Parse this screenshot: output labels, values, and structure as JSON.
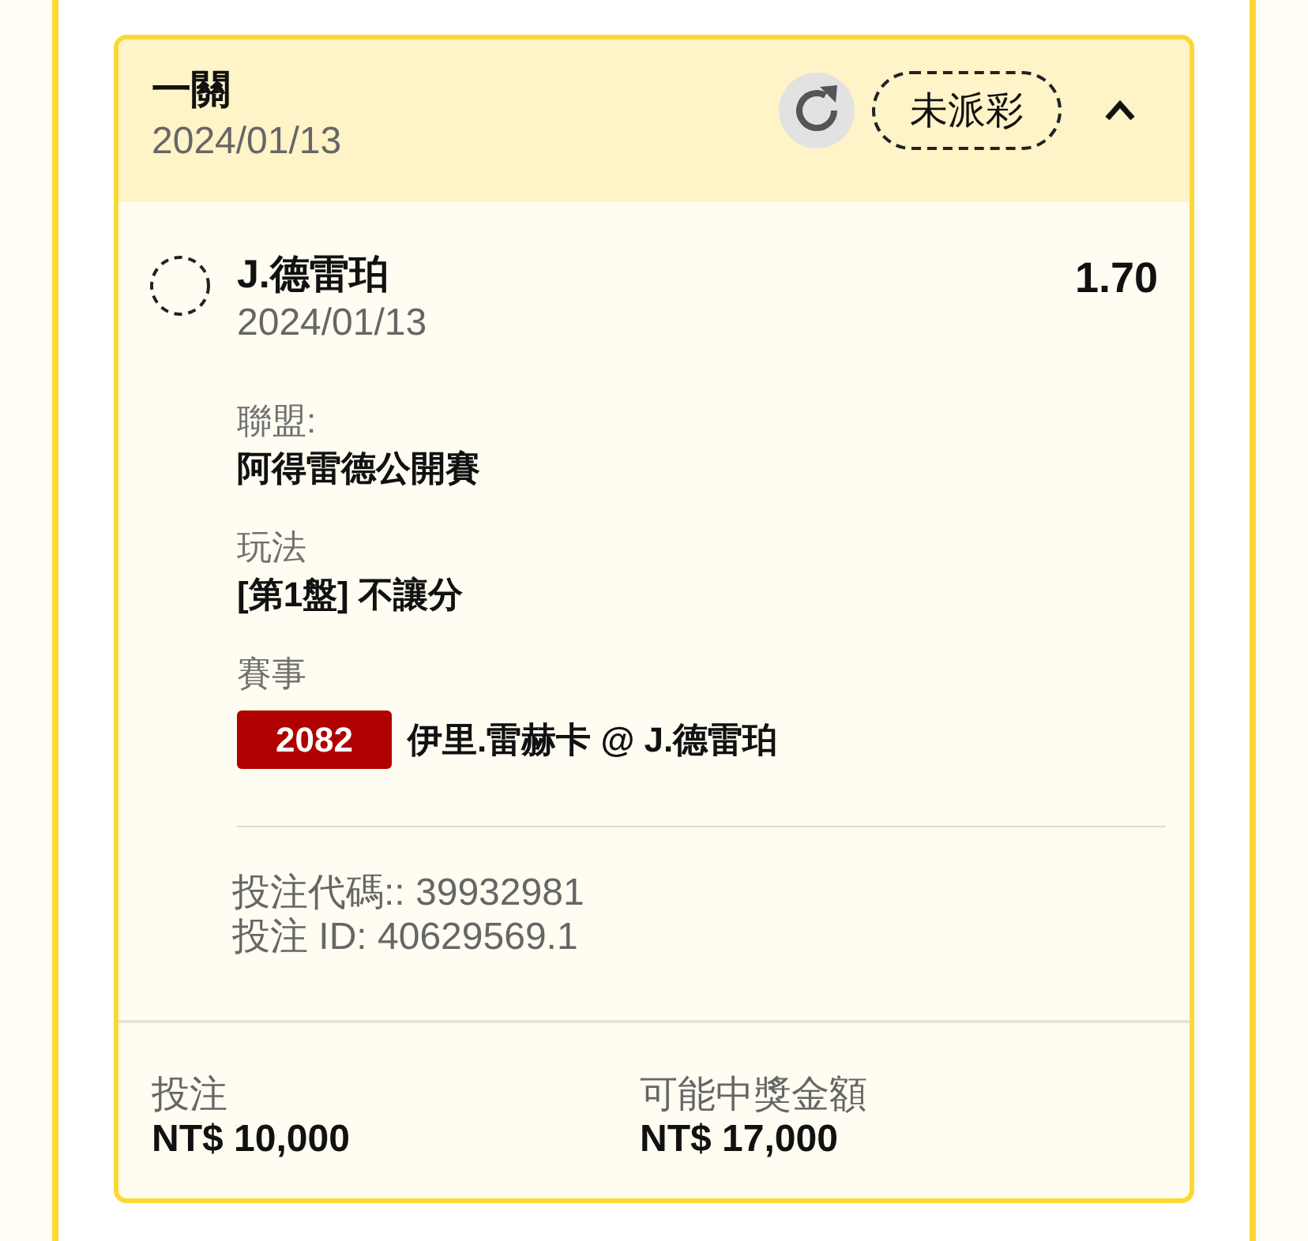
{
  "bet_card": {
    "title": "一關",
    "date": "2024/01/13",
    "status": "未派彩",
    "expanded": true
  },
  "selection": {
    "name": "J.德雷珀",
    "date": "2024/01/13",
    "odds": "1.70"
  },
  "details": [
    {
      "kind": "text",
      "label": "聯盟:",
      "value": "阿得雷德公開賽"
    },
    {
      "kind": "text",
      "label": "玩法",
      "value": "[第1盤] 不讓分"
    },
    {
      "kind": "event",
      "label": "賽事",
      "badge": "2082",
      "value": "伊里.雷赫卡 @ J.德雷珀"
    }
  ],
  "codes": [
    "投注代碼:: 39932981",
    "投注 ID: 40629569.1"
  ],
  "totals": [
    {
      "label": "投注",
      "value": "NT$ 10,000"
    },
    {
      "label": "可能中獎金額",
      "value": "NT$ 17,000"
    }
  ]
}
